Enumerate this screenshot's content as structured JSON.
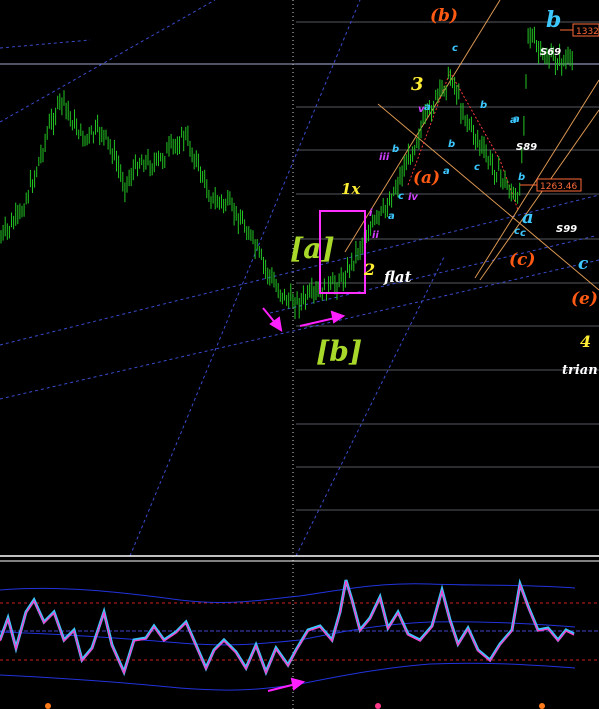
{
  "chart_data": {
    "type": "candlestick",
    "main_panel": {
      "price_tags": [
        {
          "text": "1332",
          "color": "#ff6a3a"
        },
        {
          "text": "1263.46",
          "color": "#ff6a3a"
        }
      ],
      "wave_labels": [
        {
          "text": "(b)",
          "color": "#ff5a14"
        },
        {
          "text": "b",
          "color": "#3cc8ff"
        },
        {
          "text": "3",
          "color": "#ffee33"
        },
        {
          "text": "1x",
          "color": "#ffee33"
        },
        {
          "text": "[a]",
          "color": "#a8d82a"
        },
        {
          "text": "[b]",
          "color": "#a8d82a"
        },
        {
          "text": "2",
          "color": "#ffee33"
        },
        {
          "text": "flat",
          "color": "#ffffff"
        },
        {
          "text": "(a)",
          "color": "#ff5a14"
        },
        {
          "text": "a",
          "color": "#3cc8ff"
        },
        {
          "text": "(c)",
          "color": "#ff5a14"
        },
        {
          "text": "(e)",
          "color": "#ff5a14"
        },
        {
          "text": "4",
          "color": "#ffee33"
        },
        {
          "text": "trian",
          "color": "#ffffff"
        },
        {
          "text": "c",
          "color": "#3cc8ff"
        }
      ],
      "small_labels": [
        {
          "text": "S69",
          "color": "#ffffff"
        },
        {
          "text": "S89",
          "color": "#ffffff"
        },
        {
          "text": "S99",
          "color": "#ffffff"
        },
        {
          "text": "c",
          "color": "#3cc8ff"
        },
        {
          "text": "a",
          "color": "#3cc8ff"
        },
        {
          "text": "b",
          "color": "#3cc8ff"
        },
        {
          "text": "a",
          "color": "#3cc8ff"
        },
        {
          "text": "b",
          "color": "#3cc8ff"
        },
        {
          "text": "c",
          "color": "#3cc8ff"
        },
        {
          "text": "iv",
          "color": "#d040ff"
        },
        {
          "text": "iii",
          "color": "#d040ff"
        },
        {
          "text": "i",
          "color": "#d040ff"
        },
        {
          "text": "ii",
          "color": "#d040ff"
        },
        {
          "text": "v",
          "color": "#d040ff"
        },
        {
          "text": "b",
          "color": "#3cc8ff"
        },
        {
          "text": "a",
          "color": "#3cc8ff"
        },
        {
          "text": "c",
          "color": "#3cc8ff"
        },
        {
          "text": "a",
          "color": "#3cc8ff"
        },
        {
          "text": "b",
          "color": "#3cc8ff"
        },
        {
          "text": "c",
          "color": "#3cc8ff"
        },
        {
          "text": "a",
          "color": "#3cc8ff"
        },
        {
          "text": "c",
          "color": "#3cc8ff"
        }
      ]
    },
    "oscillator_panel": {
      "series": [
        {
          "color": "#3cc8ff"
        },
        {
          "color": "#ff3cc8"
        }
      ]
    },
    "colors": {
      "background": "#000000",
      "candles": "#22c422",
      "grid": "#9aa0b0",
      "trendline": "#3a4acc",
      "channel": "#ffb060",
      "annotation_box": "#ff30ff",
      "arrows": "#ff20ff"
    }
  }
}
